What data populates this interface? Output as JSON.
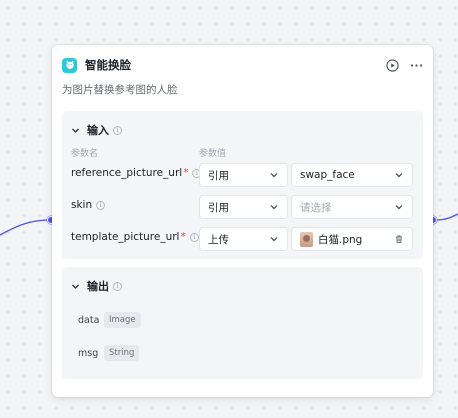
{
  "node": {
    "title": "智能换脸",
    "description": "为图片替换参考图的人脸",
    "icon": "face-swap-icon",
    "actions": [
      "run-icon",
      "more-icon"
    ]
  },
  "input": {
    "title": "输入",
    "col_name": "参数名",
    "col_value": "参数值",
    "params": [
      {
        "name": "reference_picture_url",
        "required": "*",
        "type": "引用",
        "value": "swap_face"
      },
      {
        "name": "skin",
        "required": "",
        "type": "引用",
        "placeholder": "请选择"
      },
      {
        "name": "template_picture_url",
        "required": "*",
        "type": "上传",
        "value": "白猫.png"
      }
    ]
  },
  "output": {
    "title": "输出",
    "fields": [
      {
        "name": "data",
        "type": "Image"
      },
      {
        "name": "msg",
        "type": "String"
      }
    ]
  },
  "colors": {
    "accent": "#4d53e8",
    "icon_bg": "#2ec7d8",
    "required": "#e54545"
  }
}
